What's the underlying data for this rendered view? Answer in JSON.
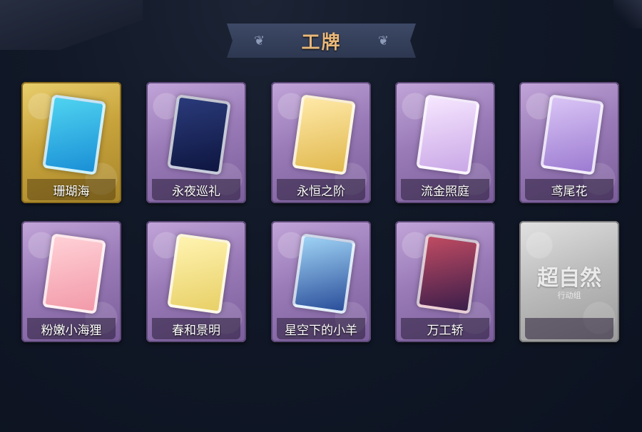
{
  "header": {
    "title": "工牌"
  },
  "cards": [
    {
      "label": "珊瑚海",
      "art": "badge-art-coral-sea-icon",
      "bg": "gold",
      "colors": [
        "#4fd3f0",
        "#1a8fd6"
      ]
    },
    {
      "label": "永夜巡礼",
      "art": "badge-art-eternal-night-icon",
      "bg": "purple",
      "colors": [
        "#2a3a7a",
        "#0e1640"
      ]
    },
    {
      "label": "永恒之阶",
      "art": "badge-art-eternal-steps-icon",
      "bg": "purple",
      "colors": [
        "#ffe9a8",
        "#e0b84e"
      ]
    },
    {
      "label": "流金照庭",
      "art": "badge-art-golden-court-icon",
      "bg": "purple",
      "colors": [
        "#f6e6ff",
        "#c9a7e6"
      ]
    },
    {
      "label": "鸢尾花",
      "art": "badge-art-iris-icon",
      "bg": "purple",
      "colors": [
        "#d9c4f5",
        "#9c7bd1"
      ]
    },
    {
      "label": "粉嫩小海狸",
      "art": "badge-art-pink-beaver-icon",
      "bg": "purple",
      "colors": [
        "#ffd0d6",
        "#f29aa9"
      ]
    },
    {
      "label": "春和景明",
      "art": "badge-art-spring-light-icon",
      "bg": "purple",
      "colors": [
        "#fff3b0",
        "#e8d067"
      ]
    },
    {
      "label": "星空下的小羊",
      "art": "badge-art-starry-lamb-icon",
      "bg": "purple",
      "colors": [
        "#9fd3f5",
        "#2a4e9a"
      ]
    },
    {
      "label": "万工轿",
      "art": "badge-art-wedding-sedan-icon",
      "bg": "purple",
      "colors": [
        "#c04b62",
        "#3a1d4a"
      ]
    },
    {
      "label": "",
      "art": "badge-art-supernatural-logo",
      "bg": "silver",
      "colors": [
        "#cfcfcf",
        "#9a9a9a"
      ],
      "logo_text": "超自然",
      "logo_sub": "行动组"
    }
  ]
}
